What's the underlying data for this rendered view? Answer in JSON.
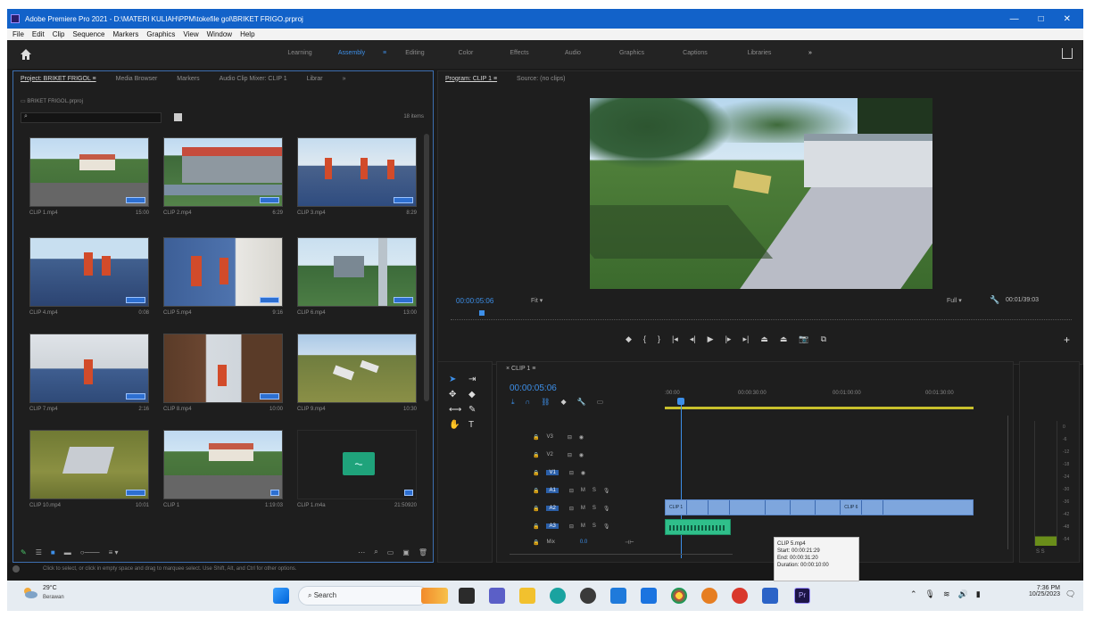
{
  "window": {
    "title": "Adobe Premiere Pro 2021 - D:\\MATERI KULIAH\\PPM\\tokefile gol\\BRIKET FRIGO.prproj",
    "controls": [
      "—",
      "□",
      "✕"
    ]
  },
  "menu": [
    "File",
    "Edit",
    "Clip",
    "Sequence",
    "Markers",
    "Graphics",
    "View",
    "Window",
    "Help"
  ],
  "workspaces": [
    "Learning",
    "Assembly",
    "Editing",
    "Color",
    "Effects",
    "Audio",
    "Graphics",
    "Captions",
    "Libraries",
    "»"
  ],
  "active_workspace": "Assembly",
  "project_panel": {
    "tabs": [
      "Project: BRIKET FRIGOL ≡",
      "Media Browser",
      "Markers",
      "Audio Clip Mixer: CLIP 1",
      "Librar",
      "»"
    ],
    "path": "BRIKET FRIGOL.prproj",
    "search_placeholder": "",
    "item_count": "18 items",
    "items": [
      {
        "name": "CLIP 1.mp4",
        "duration": "15:00"
      },
      {
        "name": "CLIP 2.mp4",
        "duration": "6:29"
      },
      {
        "name": "CLIP 3.mp4",
        "duration": "8:29"
      },
      {
        "name": "CLIP 4.mp4",
        "duration": "0:08"
      },
      {
        "name": "CLIP 5.mp4",
        "duration": "9:16"
      },
      {
        "name": "CLIP 6.mp4",
        "duration": "13:00"
      },
      {
        "name": "CLIP 7.mp4",
        "duration": "2:16"
      },
      {
        "name": "CLIP 8.mp4",
        "duration": "10:00"
      },
      {
        "name": "CLIP 9.mp4",
        "duration": "10:30"
      },
      {
        "name": "CLIP 10.mp4",
        "duration": "10:01"
      },
      {
        "name": "CLIP 1",
        "duration": "1:19:03"
      },
      {
        "name": "CLIP 1.m4a",
        "duration": "21:50920"
      }
    ]
  },
  "program_monitor": {
    "tabs": [
      "Program: CLIP 1 ≡",
      "Source: (no clips)"
    ],
    "timecode": "00:00:05:06",
    "fit": "Fit",
    "full": "Full",
    "duration": "00:01/39:03"
  },
  "timeline": {
    "sequence_tab": "CLIP 1 ≡",
    "timecode": "00:00:05:06",
    "ruler": [
      ":00:00",
      "00:00:30:00",
      "00:01:00:00",
      "00:01:30:00"
    ],
    "video_tracks": [
      "V3",
      "V2",
      "V1"
    ],
    "audio_tracks": [
      "A1",
      "A2",
      "A3"
    ],
    "mix_label": "Mix",
    "mix_value": "0.0",
    "clip_labels": [
      "CLIP 1",
      "CLIP 6"
    ],
    "tooltip": {
      "name": "CLIP 5.mp4",
      "start": "Start: 00:00:21:29",
      "end": "End: 00:00:31:20",
      "duration": "Duration: 00:00:10:00"
    }
  },
  "status_text": "Click to select, or click in empty space and drag to marquee select. Use Shift, Alt, and Ctrl for other options.",
  "taskbar": {
    "weather_temp": "29°C",
    "weather_desc": "Berawan",
    "search_label": "Search",
    "time": "7:36 PM",
    "date": "10/25/2023"
  },
  "colors": {
    "accent": "#3d8fe8",
    "video_clip": "#7ea6dd",
    "audio_clip": "#2fbf8a",
    "titlebar": "#1262c9"
  }
}
